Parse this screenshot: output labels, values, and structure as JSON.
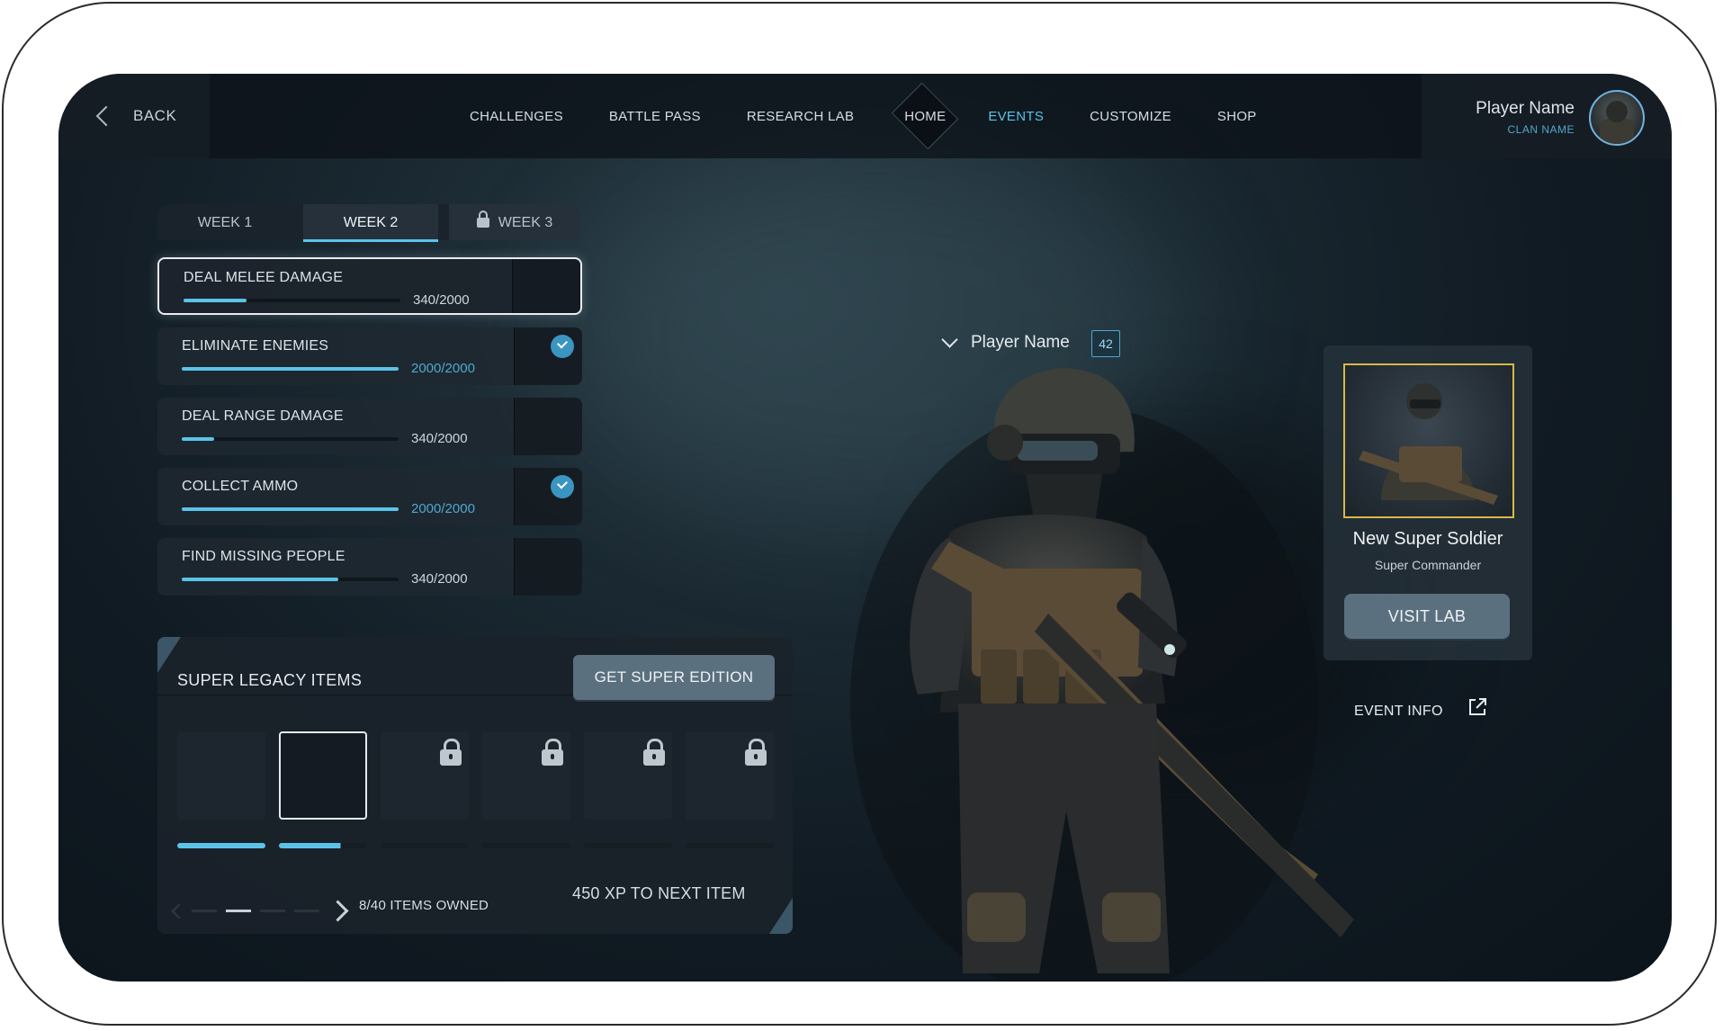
{
  "nav": {
    "back_label": "BACK",
    "items": [
      "CHALLENGES",
      "BATTLE PASS",
      "RESEARCH LAB",
      "HOME",
      "EVENTS",
      "CUSTOMIZE",
      "SHOP"
    ],
    "active": "EVENTS"
  },
  "profile": {
    "player_name": "Player Name",
    "clan_name": "CLAN NAME"
  },
  "week_tabs": [
    {
      "label": "WEEK 1",
      "locked": false
    },
    {
      "label": "WEEK 2",
      "locked": false,
      "selected": true
    },
    {
      "label": "WEEK 3",
      "locked": true
    }
  ],
  "challenges": [
    {
      "title": "DEAL MELEE DAMAGE",
      "progress": "340/2000",
      "fraction": 0.29,
      "complete": false,
      "selected": true
    },
    {
      "title": "ELIMINATE ENEMIES",
      "progress": "2000/2000",
      "fraction": 1.0,
      "complete": true
    },
    {
      "title": "DEAL RANGE DAMAGE",
      "progress": "340/2000",
      "fraction": 0.15,
      "complete": false
    },
    {
      "title": "COLLECT AMMO",
      "progress": "2000/2000",
      "fraction": 1.0,
      "complete": true
    },
    {
      "title": "FIND MISSING PEOPLE",
      "progress": "340/2000",
      "fraction": 0.72,
      "complete": false
    }
  ],
  "legacy": {
    "title": "SUPER LEGACY ITEMS",
    "button": "GET SUPER EDITION",
    "items_owned": "8/40 ITEMS OWNED",
    "xp_next": "450 XP TO NEXT ITEM",
    "slot_locked": [
      false,
      false,
      true,
      true,
      true,
      true
    ],
    "slot_progress": [
      1.0,
      0.7,
      0,
      0,
      0,
      0
    ]
  },
  "player": {
    "name": "Player Name",
    "level": "42"
  },
  "card": {
    "name": "New Super Soldier",
    "subtitle": "Super Commander",
    "button": "VISIT LAB"
  },
  "event_info": "EVENT INFO",
  "colors": {
    "accent": "#5cc3e8",
    "button": "#5b707f",
    "portrait_border": "#d7b84a"
  }
}
